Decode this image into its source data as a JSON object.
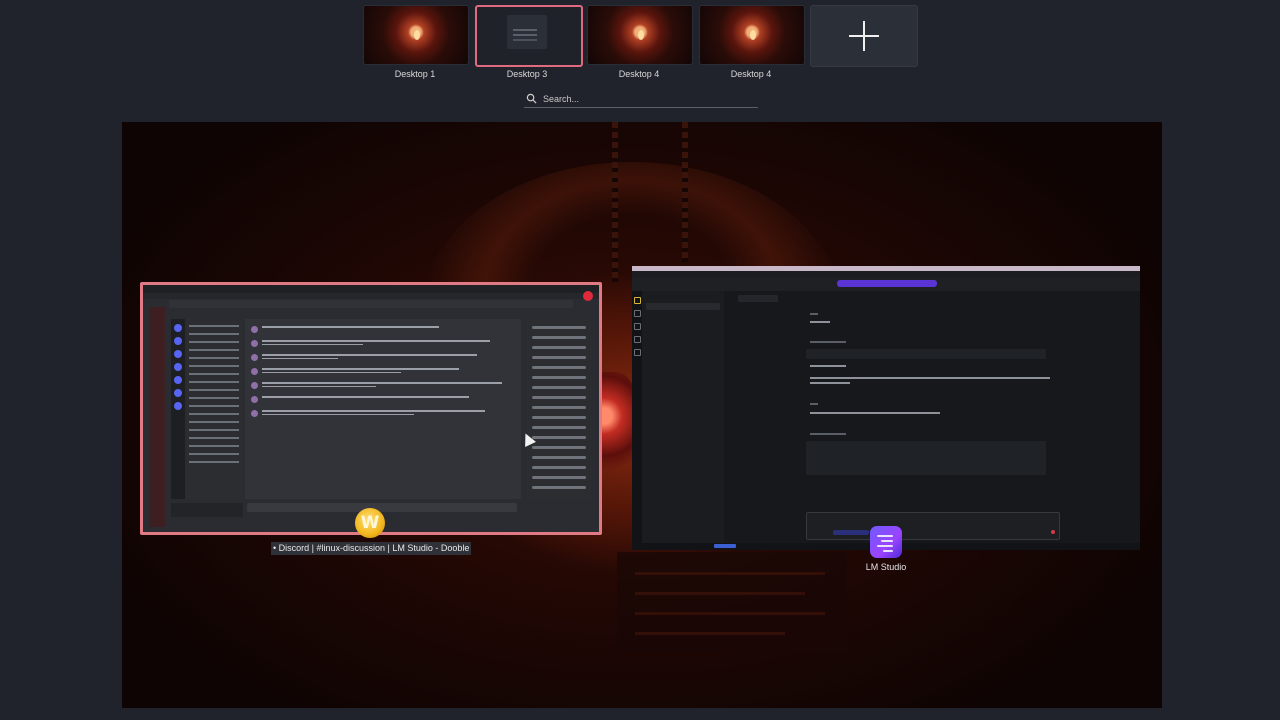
{
  "desktops": [
    {
      "label": "Desktop 1",
      "active": false
    },
    {
      "label": "Desktop 3",
      "active": true
    },
    {
      "label": "Desktop 4",
      "active": false
    },
    {
      "label": "Desktop 4",
      "active": false
    }
  ],
  "add_desktop_icon": "plus-icon",
  "search": {
    "placeholder": "Search...",
    "icon": "search-icon"
  },
  "windows": {
    "discord": {
      "caption": "• Discord | #linux-discussion | LM Studio - Dooble",
      "app_icon": "dooble-icon",
      "app_icon_glyph": "W",
      "accent": "#e07b85"
    },
    "lmstudio": {
      "label": "LM Studio",
      "app_icon": "lm-studio-icon",
      "accent": "#5b34d6"
    }
  },
  "colors": {
    "background": "#20232b",
    "active_border": "#e06b7e"
  }
}
